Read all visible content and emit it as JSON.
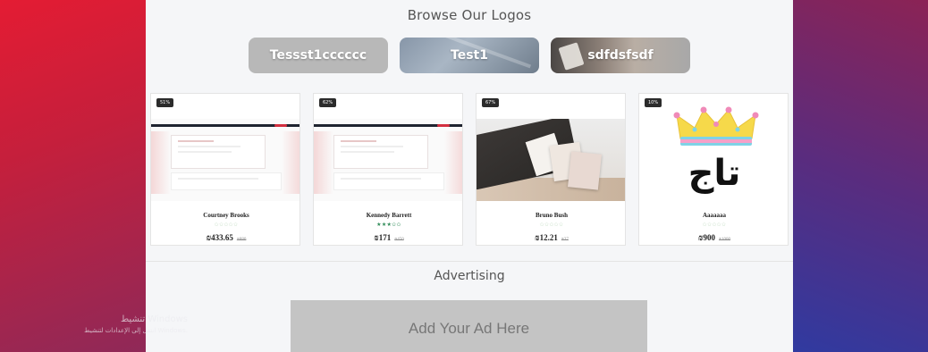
{
  "browse": {
    "title": "Browse Our Logos"
  },
  "categories": [
    {
      "label": "Tessst1cccccc"
    },
    {
      "label": "Test1"
    },
    {
      "label": "sdfdsfsdf"
    }
  ],
  "products": [
    {
      "discount": "51%",
      "name": "Courtney Brooks",
      "price": "₪433.65",
      "old_price": "₪880",
      "rating": 0
    },
    {
      "discount": "62%",
      "name": "Kennedy Barrett",
      "price": "₪171",
      "old_price": "₪450",
      "rating": 3
    },
    {
      "discount": "67%",
      "name": "Bruno Bush",
      "price": "₪12.21",
      "old_price": "₪37",
      "rating": 0
    },
    {
      "discount": "10%",
      "name": "Aaaaaaa",
      "price": "₪900",
      "old_price": "₪1000",
      "rating": 0,
      "logo_text": "تاج"
    }
  ],
  "stars_symbol": "✩✩✩✩✩",
  "stars_filled": "★★★✩✩",
  "advertising": {
    "title": "Advertising",
    "ad_label": "Add Your Ad Here"
  },
  "watermark": {
    "line1": "تنشيط Windows",
    "line2": "انتقل إلى الإعدادات لتنشيط Windows."
  },
  "colors": {
    "left_bg": "#e41c33",
    "right_bg": "#303aa0",
    "center_bg": "#f5f6f8",
    "ad_bg": "#c4c4c4"
  }
}
